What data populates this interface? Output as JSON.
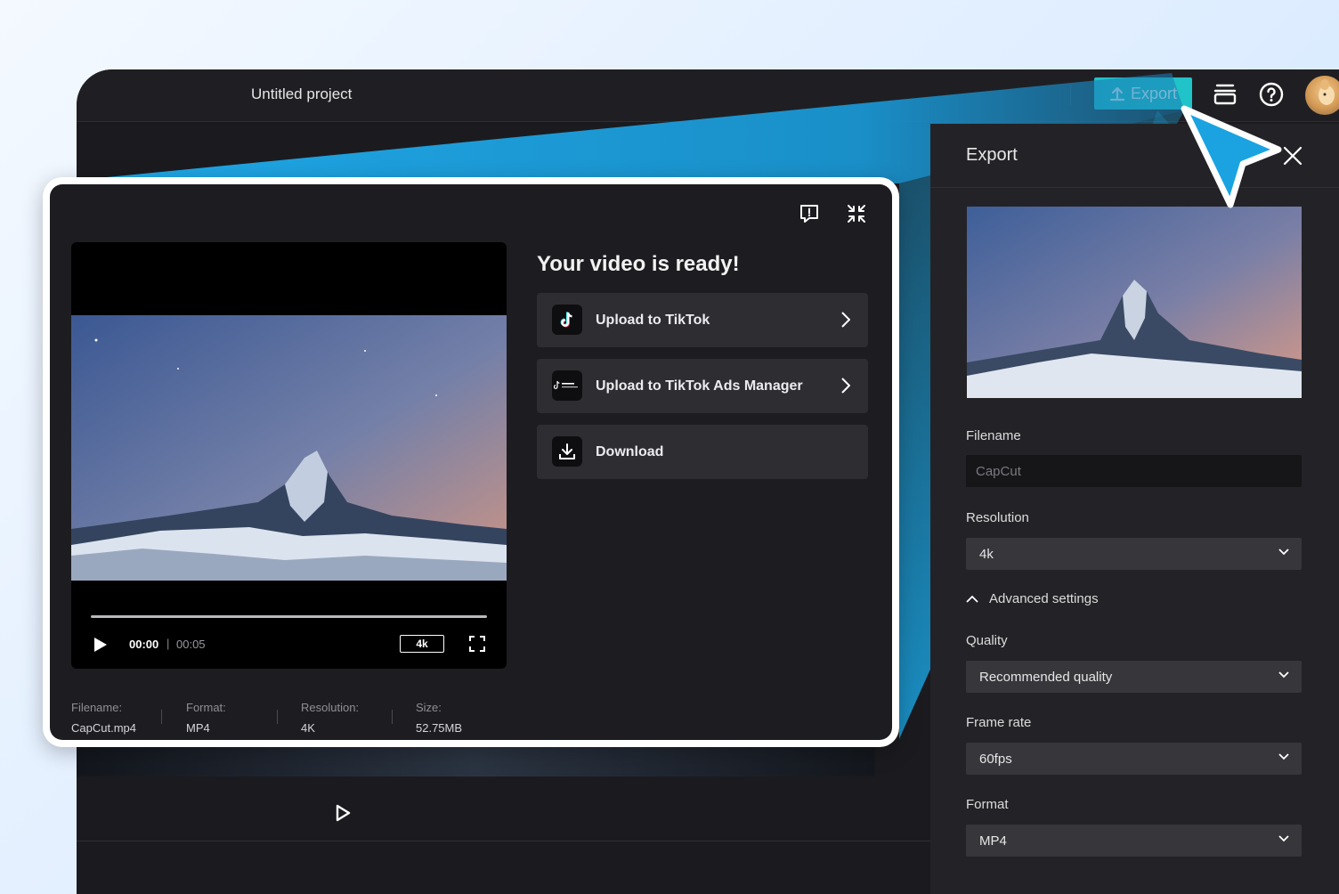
{
  "topbar": {
    "project_title": "Untitled project",
    "export_label": "Export",
    "icons": [
      "upload-icon",
      "stack-icon",
      "help-icon"
    ]
  },
  "export_panel": {
    "title": "Export",
    "filename_label": "Filename",
    "filename_placeholder": "CapCut",
    "resolution_label": "Resolution",
    "resolution_value": "4k",
    "advanced_label": "Advanced settings",
    "quality_label": "Quality",
    "quality_value": "Recommended quality",
    "framerate_label": "Frame rate",
    "framerate_value": "60fps",
    "format_label": "Format",
    "format_value": "MP4"
  },
  "modal": {
    "title": "Your video is ready!",
    "actions": [
      {
        "label": "Upload to TikTok",
        "icon": "tiktok-icon"
      },
      {
        "label": "Upload to TikTok Ads Manager",
        "icon": "tiktok-for-business-icon"
      },
      {
        "label": "Download",
        "icon": "download-icon"
      }
    ],
    "player": {
      "current_time": "00:00",
      "separator": "|",
      "total_time": "00:05",
      "resolution_badge": "4k",
      "progress": 0
    },
    "meta": [
      {
        "label": "Filename:",
        "value": "CapCut.mp4"
      },
      {
        "label": "Format:",
        "value": "MP4"
      },
      {
        "label": "Resolution:",
        "value": "4K"
      },
      {
        "label": "Size:",
        "value": "52.75MB"
      }
    ]
  },
  "colors": {
    "accent": "#20c3c8",
    "beam": "#1aa3e0",
    "panel_bg": "#232327",
    "modal_bg": "#1d1d21"
  }
}
